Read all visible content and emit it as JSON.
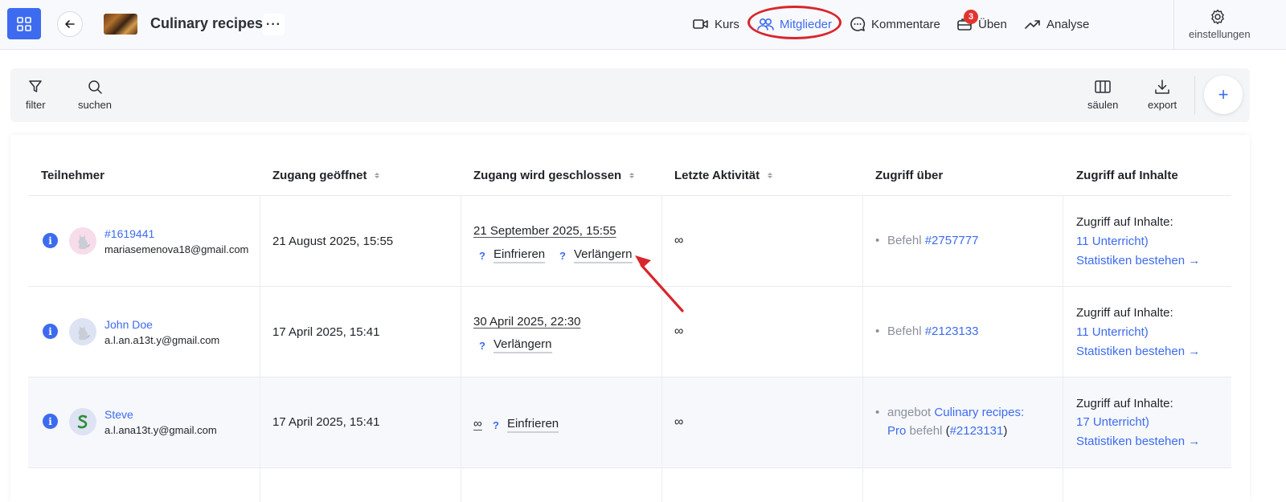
{
  "header": {
    "course_title": "Culinary recipes",
    "more": "···",
    "nav": [
      {
        "label": "Kurs",
        "icon": "video-icon"
      },
      {
        "label": "Mitglieder",
        "icon": "users-icon",
        "active": true
      },
      {
        "label": "Kommentare",
        "icon": "comment-icon"
      },
      {
        "label": "Üben",
        "icon": "briefcase-icon",
        "badge": "3"
      },
      {
        "label": "Analyse",
        "icon": "trend-up-icon"
      }
    ],
    "settings_label": "einstellungen"
  },
  "toolbar": {
    "filter_label": "filter",
    "search_label": "suchen",
    "columns_label": "säulen",
    "export_label": "export",
    "add_label": "+"
  },
  "table": {
    "columns": [
      "Teilnehmer",
      "Zugang geöffnet",
      "Zugang wird geschlossen",
      "Letzte Aktivität",
      "Zugriff über",
      "Zugriff auf Inhalte"
    ],
    "rows": [
      {
        "name": "#1619441",
        "email": "mariasemenova18@gmail.com",
        "opened": "21 August 2025, 15:55",
        "closes": "21 September 2025, 15:55",
        "actions": [
          "Einfrieren",
          "Verlängern"
        ],
        "last_activity": "∞",
        "via_prefix": "Befehl",
        "via_link": "#2757777",
        "content_title": "Zugriff auf Inhalte:",
        "content_link": "11 Unterricht)",
        "stats_link": "Statistiken bestehen →"
      },
      {
        "name": "John Doe",
        "email": "a.l.an.a13t.y@gmail.com",
        "opened": "17 April 2025, 15:41",
        "closes": "30 April 2025, 22:30",
        "actions": [
          "Verlängern"
        ],
        "last_activity": "∞",
        "via_prefix": "Befehl",
        "via_link": "#2123133",
        "content_title": "Zugriff auf Inhalte:",
        "content_link": "11 Unterricht)",
        "stats_link": "Statistiken bestehen →"
      },
      {
        "name": "Steve",
        "email": "a.l.ana13t.y@gmail.com",
        "opened": "17 April 2025, 15:41",
        "closes": "∞",
        "actions": [
          "Einfrieren"
        ],
        "last_activity": "∞",
        "via_prefix": "angebot",
        "via_link": "Culinary recipes:",
        "via_link2": "Pro",
        "via_mid": "befehl",
        "via_paren_open": "(",
        "via_link3": "#2123131",
        "via_paren_close": ")",
        "content_title": "Zugriff auf Inhalte:",
        "content_link": "17 Unterricht)",
        "stats_link": "Statistiken bestehen →"
      }
    ],
    "action_marker": "?",
    "info_marker": "i"
  },
  "colors": {
    "accent": "#3d6bf0",
    "highlight": "#d8262c",
    "badge": "#e2342f"
  }
}
